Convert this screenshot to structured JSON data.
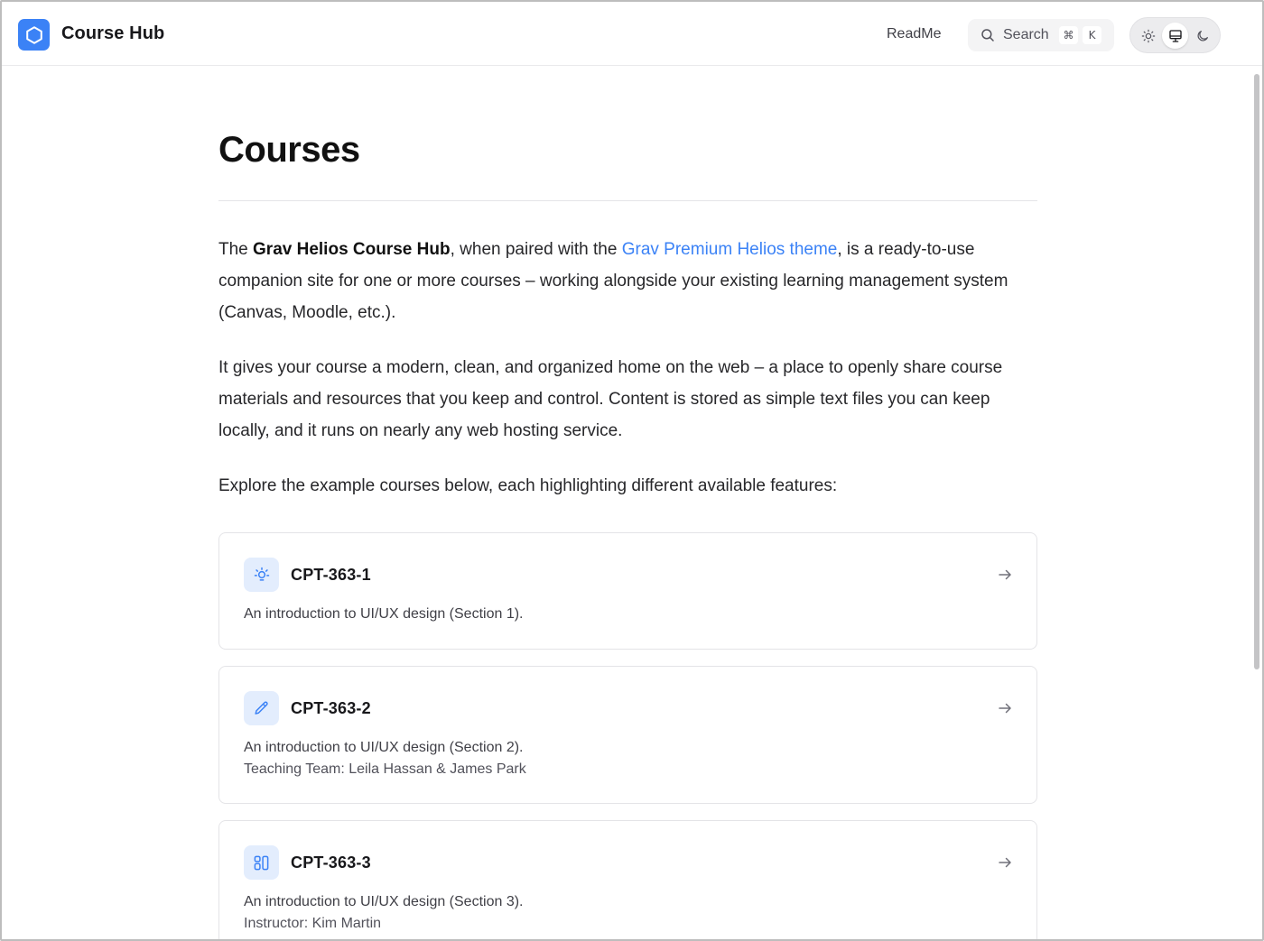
{
  "header": {
    "brand": "Course Hub",
    "nav_readme": "ReadMe",
    "search": {
      "label": "Search",
      "kbd_mod": "⌘",
      "kbd_key": "K"
    },
    "theme_modes": [
      "light",
      "system",
      "dark"
    ],
    "theme_active": "system"
  },
  "colors": {
    "accent": "#3b82f6",
    "icon_bg": "#e3edfd"
  },
  "page": {
    "title": "Courses",
    "intro": {
      "p1_start": "The ",
      "p1_bold": "Grav Helios Course Hub",
      "p1_mid": ", when paired with the ",
      "p1_link": "Grav Premium Helios theme",
      "p1_end": ", is a ready-to-use companion site for one or more courses – working alongside your existing learning management system (Canvas, Moodle, etc.).",
      "p2": "It gives your course a modern, clean, and organized home on the web – a place to openly share course materials and resources that you keep and control. Content is stored as simple text files you can keep locally, and it runs on nearly any web hosting service.",
      "p3": "Explore the example courses below, each highlighting different available features:"
    },
    "courses": [
      {
        "code": "CPT-363-1",
        "icon": "lightbulb-icon",
        "description": "An introduction to UI/UX design (Section 1).",
        "meta": ""
      },
      {
        "code": "CPT-363-2",
        "icon": "pencil-icon",
        "description": "An introduction to UI/UX design (Section 2).",
        "meta": "Teaching Team: Leila Hassan & James Park"
      },
      {
        "code": "CPT-363-3",
        "icon": "layout-icon",
        "description": "An introduction to UI/UX design (Section 3).",
        "meta": "Instructor: Kim Martin"
      }
    ]
  }
}
